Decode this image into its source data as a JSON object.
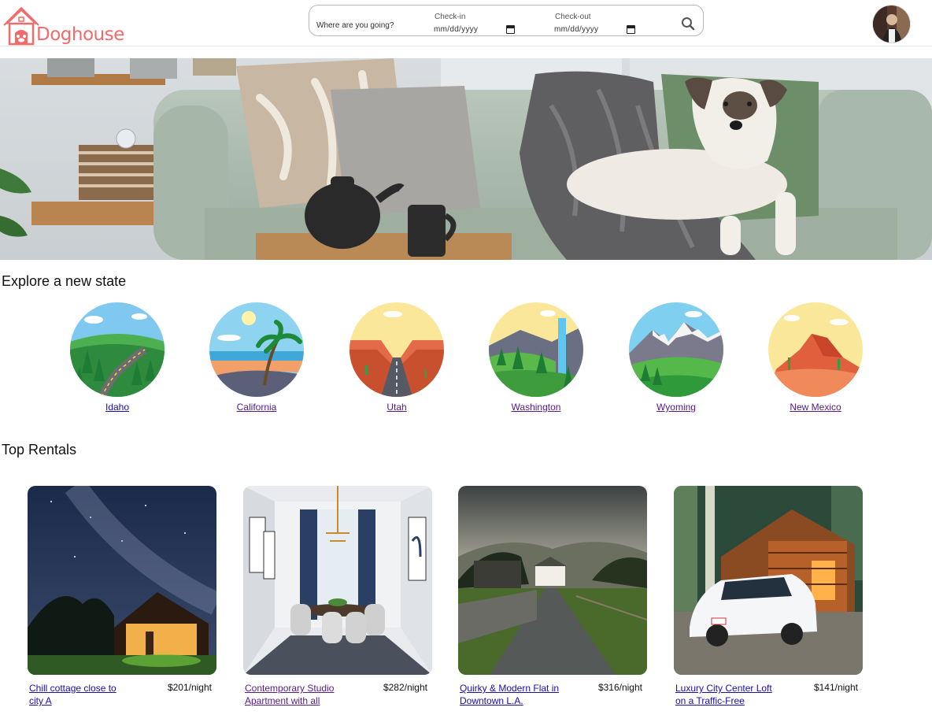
{
  "brand": {
    "name": "Doghouse",
    "color": "#f26a6a"
  },
  "search": {
    "where_placeholder": "Where are you going?",
    "checkin_label": "Check-in",
    "checkin_value": "mm/dd/yyyy",
    "checkout_label": "Check-out",
    "checkout_value": "mm/dd/yyyy",
    "icon": "search-icon"
  },
  "explore": {
    "title": "Explore a new state",
    "states": [
      {
        "name": "Idaho"
      },
      {
        "name": "California"
      },
      {
        "name": "Utah"
      },
      {
        "name": "Washington"
      },
      {
        "name": "Wyoming"
      },
      {
        "name": "New Mexico"
      }
    ]
  },
  "rentals": {
    "title": "Top Rentals",
    "items": [
      {
        "title": "Chill cottage close to city A",
        "price": "$201/night"
      },
      {
        "title": "Contemporary Studio Apartment with all",
        "price": "$282/night"
      },
      {
        "title": "Quirky & Modern Flat in Downtown L.A.",
        "price": "$316/night"
      },
      {
        "title": "Luxury City Center Loft on a Traffic-Free",
        "price": "$141/night"
      }
    ]
  },
  "colors": {
    "link_visited": "#551a8b",
    "link_unvisited": "#1a0dab"
  }
}
